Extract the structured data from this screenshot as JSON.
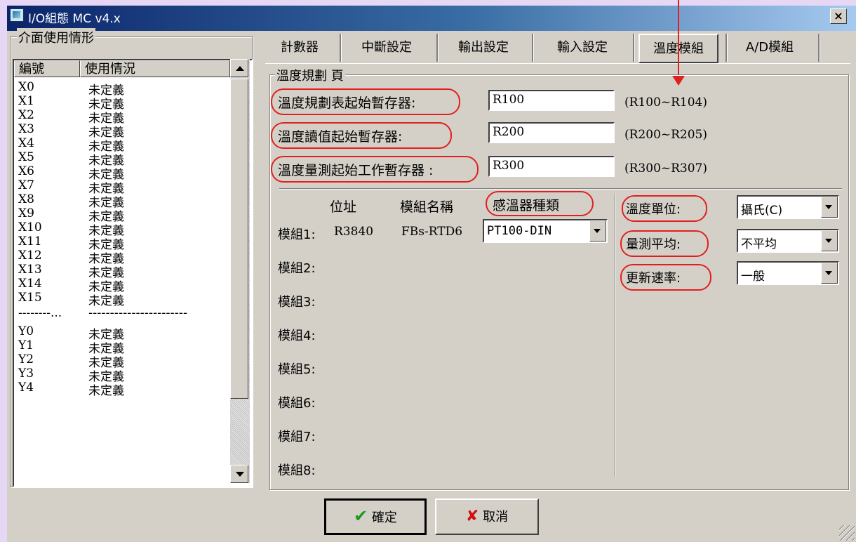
{
  "window": {
    "title": "I/O組態 MC v4.x",
    "close_glyph": "×"
  },
  "left_panel": {
    "group_title": "介面使用情形",
    "columns": [
      "編號",
      "使用情況"
    ],
    "rows": [
      {
        "code": "X0",
        "usage": "未定義"
      },
      {
        "code": "X1",
        "usage": "未定義"
      },
      {
        "code": "X2",
        "usage": "未定義"
      },
      {
        "code": "X3",
        "usage": "未定義"
      },
      {
        "code": "X4",
        "usage": "未定義"
      },
      {
        "code": "X5",
        "usage": "未定義"
      },
      {
        "code": "X6",
        "usage": "未定義"
      },
      {
        "code": "X7",
        "usage": "未定義"
      },
      {
        "code": "X8",
        "usage": "未定義"
      },
      {
        "code": "X9",
        "usage": "未定義"
      },
      {
        "code": "X10",
        "usage": "未定義"
      },
      {
        "code": "X11",
        "usage": "未定義"
      },
      {
        "code": "X12",
        "usage": "未定義"
      },
      {
        "code": "X13",
        "usage": "未定義"
      },
      {
        "code": "X14",
        "usage": "未定義"
      },
      {
        "code": "X15",
        "usage": "未定義"
      },
      {
        "code": "--------...",
        "usage": "-----------------------"
      },
      {
        "code": "Y0",
        "usage": "未定義"
      },
      {
        "code": "Y1",
        "usage": "未定義"
      },
      {
        "code": "Y2",
        "usage": "未定義"
      },
      {
        "code": "Y3",
        "usage": "未定義"
      },
      {
        "code": "Y4",
        "usage": "未定義"
      }
    ]
  },
  "tabs": [
    "計數器",
    "中斷設定",
    "輸出設定",
    "輸入設定",
    "溫度模組",
    "A/D模組"
  ],
  "active_tab": "溫度模組",
  "content": {
    "group_title": "溫度規劃 頁",
    "registers": [
      {
        "label": "溫度規劃表起始暫存器:",
        "value": "R100",
        "range": "(R100~R104)"
      },
      {
        "label": "溫度讀值起始暫存器:",
        "value": "R200",
        "range": "(R200~R205)"
      },
      {
        "label": "溫度量測起始工作暫存器 :",
        "value": "R300",
        "range": "(R300~R307)"
      }
    ],
    "module_headers": {
      "address": "位址",
      "name": "模組名稱",
      "sensor": "感溫器種類"
    },
    "modules": [
      {
        "label": "模組1:",
        "address": "R3840",
        "name": "FBs-RTD6",
        "sensor": "PT100-DIN"
      },
      {
        "label": "模組2:"
      },
      {
        "label": "模組3:"
      },
      {
        "label": "模組4:"
      },
      {
        "label": "模組5:"
      },
      {
        "label": "模組6:"
      },
      {
        "label": "模組7:"
      },
      {
        "label": "模組8:"
      }
    ],
    "settings": [
      {
        "label": "溫度單位:",
        "value": "攝氏(C)"
      },
      {
        "label": "量測平均:",
        "value": "不平均"
      },
      {
        "label": "更新速率:",
        "value": "一般"
      }
    ]
  },
  "buttons": {
    "ok": "確定",
    "cancel": "取消"
  },
  "colors": {
    "annotation_red": "#e02020",
    "dialog_gray": "#d4d0c8",
    "frame_lavender": "#e6d8f4"
  }
}
